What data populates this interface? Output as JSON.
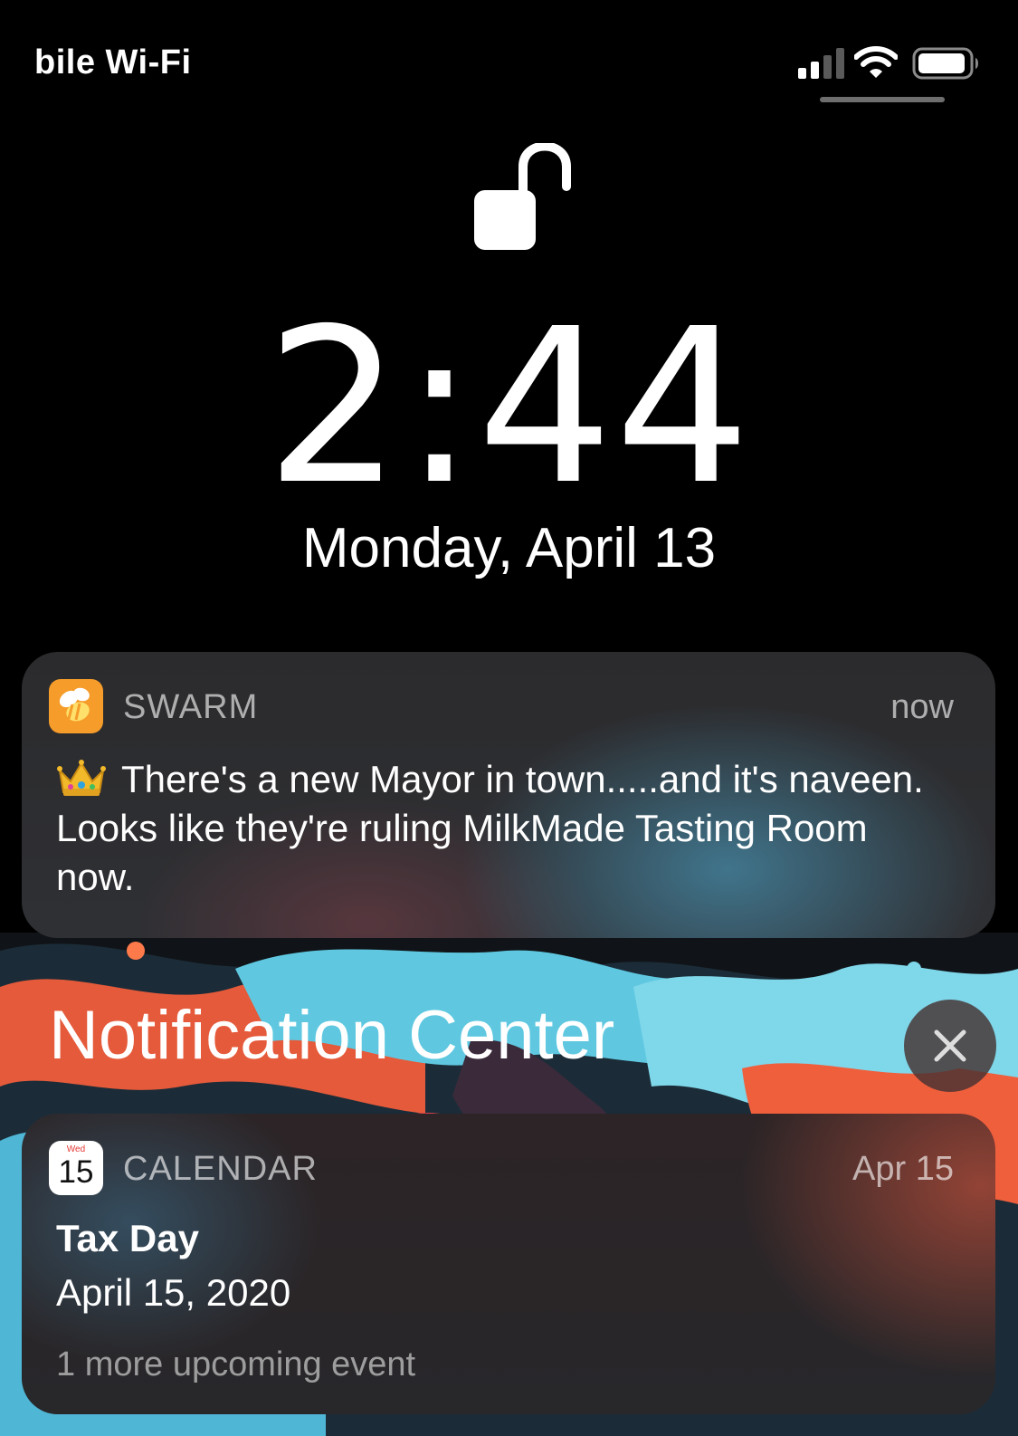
{
  "status_bar": {
    "carrier": "bile Wi-Fi",
    "signal_bars_active": 2,
    "signal_bars_total": 4,
    "wifi": "wifi-icon",
    "battery_level": 0.85
  },
  "lock_screen": {
    "lock_state": "unlocked",
    "time": "2:44",
    "date": "Monday, April 13"
  },
  "notifications": [
    {
      "app": "SWARM",
      "icon": "swarm-bee-icon",
      "time": "now",
      "emoji": "crown-emoji",
      "message": "There's a new Mayor in town.....and it's naveen. Looks like they're ruling MilkMade Tasting Room now."
    }
  ],
  "notification_center": {
    "title": "Notification Center",
    "close_icon": "close-icon",
    "items": [
      {
        "app": "CALENDAR",
        "icon_weekday": "Wed",
        "icon_day": "15",
        "time": "Apr 15",
        "event_title": "Tax Day",
        "event_date": "April 15, 2020",
        "more": "1 more upcoming event"
      }
    ]
  },
  "colors": {
    "swarm_orange": "#f59c2a",
    "calendar_red": "#e53935",
    "background": "#000000"
  }
}
